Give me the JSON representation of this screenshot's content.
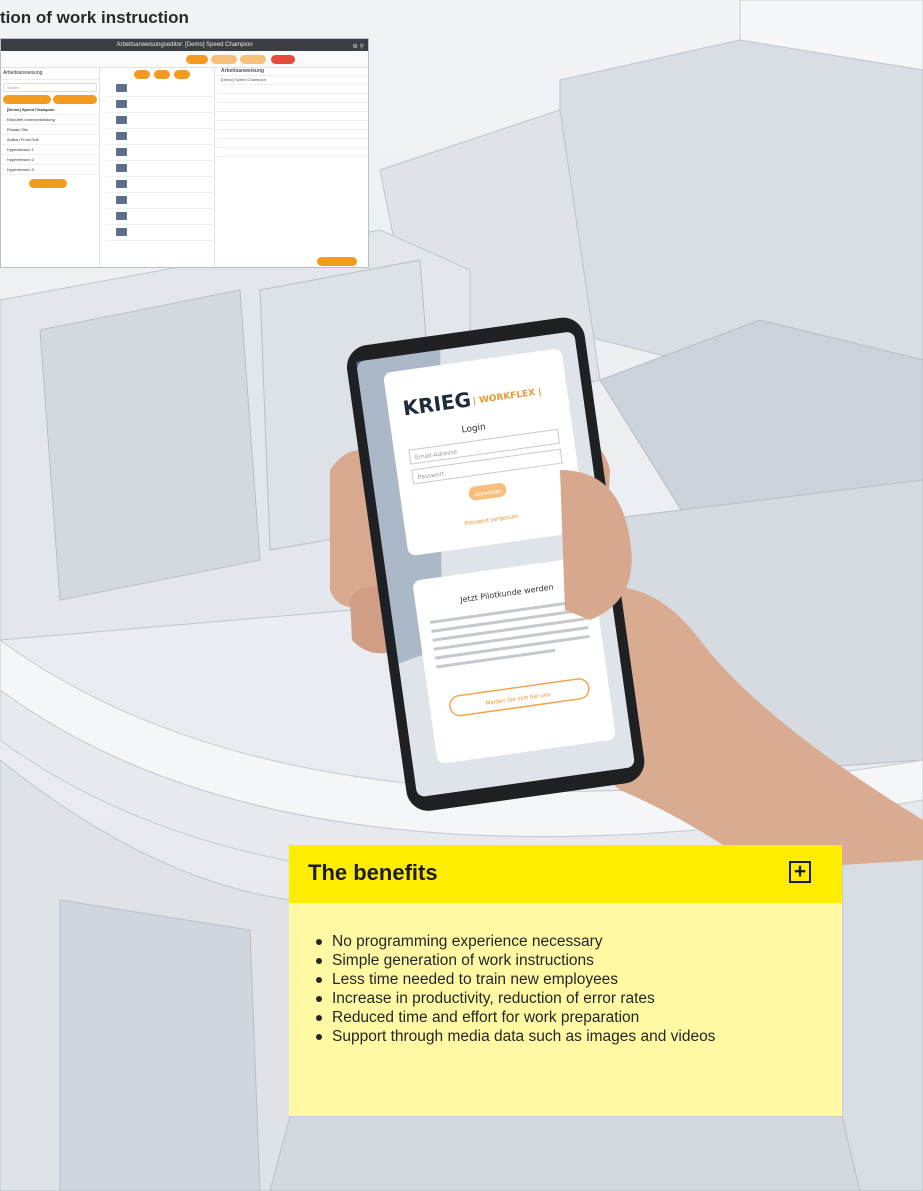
{
  "caption": "tion of work instruction",
  "editor": {
    "title": "Arbeitsanweisungseditor: [Demo] Speed Champion",
    "left_header": "Arbeitsanweisung",
    "search_placeholder": "Suche",
    "tree": [
      "[Demo] Speed Champion",
      "Eiswürfel Innenverkleidung",
      "Einsatz Sitz",
      "Aufbau Front Grill",
      "Hypertension 1",
      "Hypertension 2",
      "Hypertension 3"
    ],
    "right_header": "Arbeitsanweisung",
    "right_value": "[Demo] Speed Champion"
  },
  "phone": {
    "brand_left": "KRIEG",
    "brand_right": "WORKFLEX",
    "login_title": "Login",
    "email_placeholder": "Email-Adresse",
    "password_placeholder": "Passwort",
    "login_button": "Anmelden",
    "forgot_link": "Passwort vergessen",
    "pilot_title": "Jetzt Pilotkunde werden",
    "pilot_text": "Starten Sie gemeinsam mit uns in die Erstellung digitaler Arbeitsanweisungen. Wir bieten Ihnen die Möglichkeit vorhandene Arbeitsanweisungen für Sie einzupflegen, die über öffentlich zugängliche Links geteilt werden können. So entsteht Sie ganz leicht Informationen ohne zusätzlichen Aufwand.",
    "pilot_button": "Melden Sie sich bei uns"
  },
  "benefits": {
    "title": "The benefits",
    "toggle": "+",
    "items": [
      "No programming experience necessary",
      "Simple generation of work instructions",
      "Less time needed to train new employees",
      "Increase in productivity, reduction of error rates",
      "Reduced time and effort for work preparation",
      "Support through media data such as images and videos"
    ]
  },
  "colors": {
    "accent_yellow": "#ffed00",
    "panel_yellow": "#fff9a3",
    "orange": "#f39a1f"
  }
}
